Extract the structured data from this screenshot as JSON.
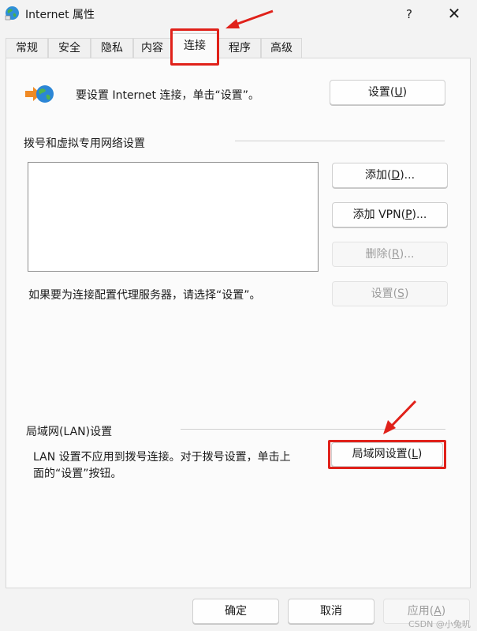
{
  "window": {
    "title": "Internet 属性",
    "help_label": "?",
    "close_label": "✕"
  },
  "tabs": [
    {
      "label": "常规",
      "active": false
    },
    {
      "label": "安全",
      "active": false
    },
    {
      "label": "隐私",
      "active": false
    },
    {
      "label": "内容",
      "active": false
    },
    {
      "label": "连接",
      "active": true
    },
    {
      "label": "程序",
      "active": false
    },
    {
      "label": "高级",
      "active": false
    }
  ],
  "setup": {
    "text": "要设置 Internet 连接，单击“设置”。",
    "button_label": "设置",
    "button_key": "U"
  },
  "dialup": {
    "group_label": "拨号和虚拟专用网络设置",
    "add_label": "添加",
    "add_key": "D",
    "add_suffix": "...",
    "add_vpn_label": "添加 VPN",
    "add_vpn_key": "P",
    "add_vpn_suffix": "...",
    "remove_label": "删除",
    "remove_key": "R",
    "remove_suffix": "...",
    "proxy_note": "如果要为连接配置代理服务器，请选择“设置”。",
    "settings_label": "设置",
    "settings_key": "S"
  },
  "lan": {
    "group_label": "局域网(LAN)设置",
    "note_line1": "LAN 设置不应用到拨号连接。对于拨号设置，单击上",
    "note_line2": "面的“设置”按钮。",
    "button_label": "局域网设置",
    "button_key": "L"
  },
  "footer": {
    "ok_label": "确定",
    "cancel_label": "取消",
    "apply_label": "应用",
    "apply_key": "A"
  },
  "watermark": "CSDN @小兔叽",
  "colors": {
    "highlight": "#e0211a",
    "disabled_text": "#9d9d9d"
  }
}
